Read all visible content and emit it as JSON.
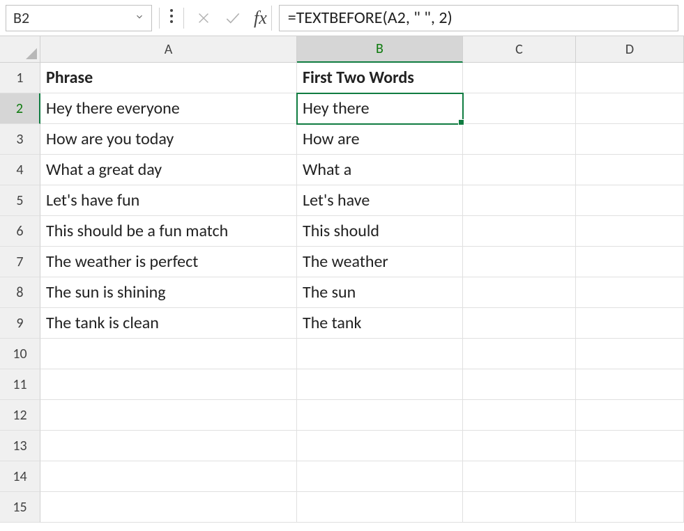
{
  "nameBox": "B2",
  "formulaBar": "=TEXTBEFORE(A2, \" \", 2)",
  "fxLabel": "fx",
  "columns": [
    "A",
    "B",
    "C",
    "D"
  ],
  "activeColumn": "B",
  "activeRow": 2,
  "selectedCell": "B2",
  "headers": {
    "A": "Phrase",
    "B": "First Two Words"
  },
  "rows": [
    {
      "num": 1,
      "A": "Phrase",
      "B": "First Two Words",
      "bold": true
    },
    {
      "num": 2,
      "A": "Hey there everyone",
      "B": "Hey there"
    },
    {
      "num": 3,
      "A": "How are you today",
      "B": "How are"
    },
    {
      "num": 4,
      "A": "What a great day",
      "B": "What a"
    },
    {
      "num": 5,
      "A": "Let's have fun",
      "B": "Let's have"
    },
    {
      "num": 6,
      "A": "This should be a fun match",
      "B": "This should"
    },
    {
      "num": 7,
      "A": "The weather is perfect",
      "B": "The weather"
    },
    {
      "num": 8,
      "A": "The sun is shining",
      "B": "The sun"
    },
    {
      "num": 9,
      "A": "The tank is clean",
      "B": "The tank"
    },
    {
      "num": 10,
      "A": "",
      "B": ""
    },
    {
      "num": 11,
      "A": "",
      "B": ""
    },
    {
      "num": 12,
      "A": "",
      "B": ""
    },
    {
      "num": 13,
      "A": "",
      "B": ""
    },
    {
      "num": 14,
      "A": "",
      "B": ""
    },
    {
      "num": 15,
      "A": "",
      "B": ""
    }
  ]
}
